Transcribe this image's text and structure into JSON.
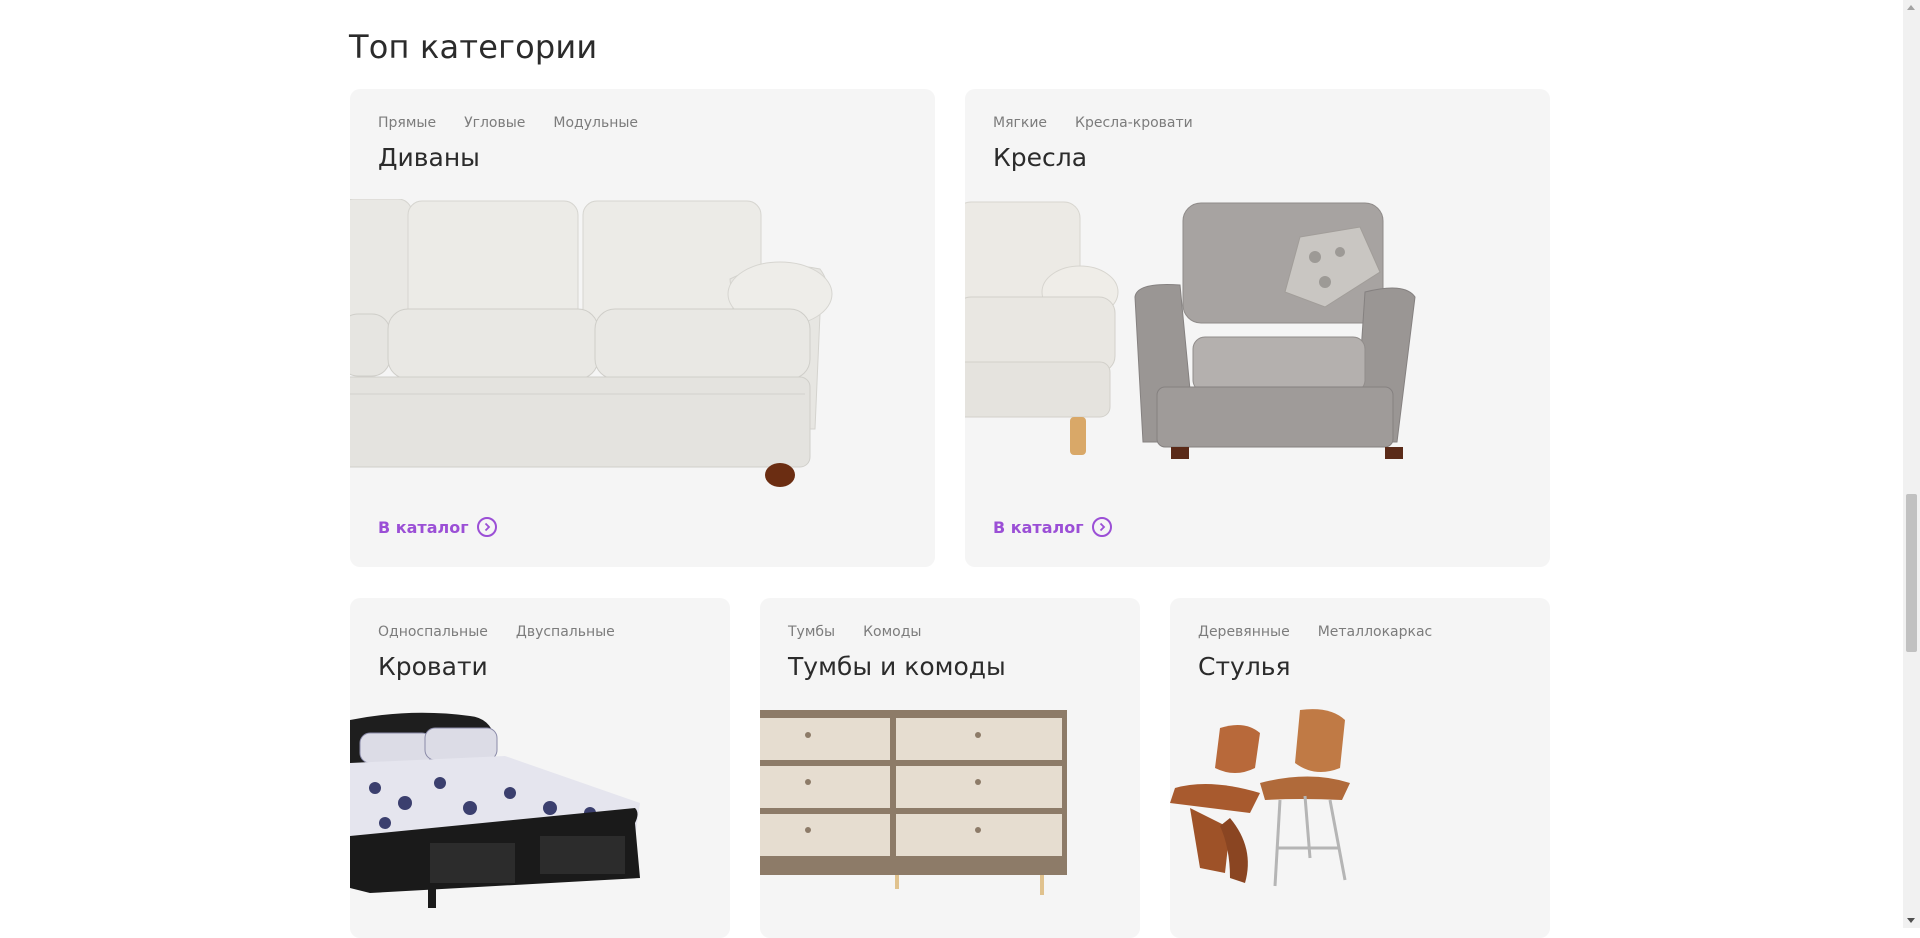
{
  "section": {
    "title": "Топ категории"
  },
  "accent_color": "#9b4fd6",
  "cards": [
    {
      "title": "Диваны",
      "tags": [
        "Прямые",
        "Угловые",
        "Модульные"
      ],
      "link": "В каталог",
      "image": "sofa-image"
    },
    {
      "title": "Кресла",
      "tags": [
        "Мягкие",
        "Кресла-кровати"
      ],
      "link": "В каталог",
      "image": "armchairs-image"
    },
    {
      "title": "Кровати",
      "tags": [
        "Односпальные",
        "Двуспальные"
      ],
      "image": "bed-image"
    },
    {
      "title": "Тумбы и комоды",
      "tags": [
        "Тумбы",
        "Комоды"
      ],
      "image": "dresser-image"
    },
    {
      "title": "Стулья",
      "tags": [
        "Деревянные",
        "Металлокаркас"
      ],
      "image": "chairs-image"
    }
  ]
}
